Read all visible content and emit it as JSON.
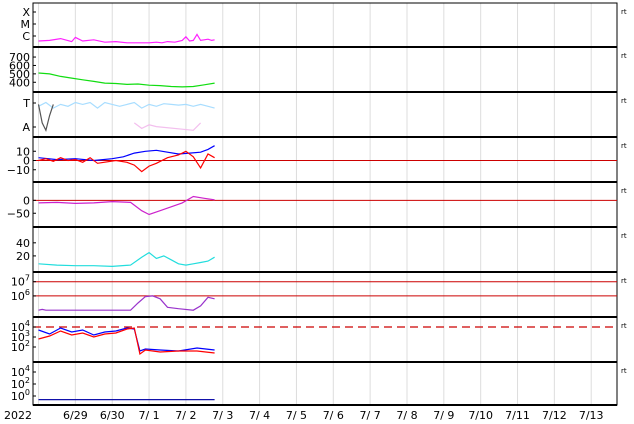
{
  "colors": {
    "magenta": "#ff22ff",
    "green": "#11dd11",
    "lightblue": "#a8ddff",
    "pink": "#f3bfee",
    "red": "#ff0000",
    "blue": "#0000ff",
    "purple": "#cc22cc",
    "cyan": "#22dddd",
    "violet": "#9933cc",
    "darkred": "#cc0000",
    "darkblue": "#1111aa",
    "gray": "#555555"
  },
  "chart_data": {
    "type": "line",
    "grid": true,
    "xlabel": "",
    "date_labels": [
      "2022",
      "6/29",
      "6/30",
      "7/ 1",
      "7/ 2",
      "7/ 3",
      "7/ 4",
      "7/ 5",
      "7/ 6",
      "7/ 7",
      "7/ 8",
      "7/ 9",
      "7/10",
      "7/11",
      "7/12",
      "7/13"
    ],
    "x_days": [
      "2022-06-28",
      "2022-06-29",
      "2022-06-30",
      "2022-07-01",
      "2022-07-02",
      "2022-07-03",
      "2022-07-04",
      "2022-07-05",
      "2022-07-06",
      "2022-07-07",
      "2022-07-08",
      "2022-07-09",
      "2022-07-10",
      "2022-07-11",
      "2022-07-12",
      "2022-07-13"
    ],
    "right_marker": "rt",
    "panels": [
      {
        "id": "xray",
        "tick_labels": [
          "X",
          "M",
          "C"
        ],
        "ylim": [
          0,
          3
        ],
        "series": [
          {
            "color": "magenta",
            "x": [
              0,
              0.3,
              0.6,
              0.9,
              1.0,
              1.2,
              1.5,
              1.8,
              2.1,
              2.4,
              2.7,
              3.0,
              3.2,
              3.35,
              3.5,
              3.7,
              3.9,
              4.0,
              4.1,
              4.2,
              4.3,
              4.4,
              4.5,
              4.6,
              4.7,
              4.78
            ],
            "y": [
              0.25,
              0.3,
              0.45,
              0.2,
              0.55,
              0.25,
              0.35,
              0.15,
              0.2,
              0.1,
              0.1,
              0.1,
              0.15,
              0.1,
              0.2,
              0.15,
              0.3,
              0.6,
              0.25,
              0.3,
              0.8,
              0.3,
              0.35,
              0.4,
              0.3,
              0.35
            ]
          }
        ]
      },
      {
        "id": "solar-wind-speed",
        "tick_labels": [
          "700",
          "600",
          "500",
          "400"
        ],
        "tick_values": [
          700,
          600,
          500,
          400
        ],
        "ylim": [
          320,
          760
        ],
        "series": [
          {
            "color": "green",
            "x": [
              0,
              0.3,
              0.6,
              0.9,
              1.2,
              1.5,
              1.8,
              2.1,
              2.4,
              2.7,
              3.0,
              3.3,
              3.6,
              3.9,
              4.2,
              4.5,
              4.78
            ],
            "y": [
              510,
              500,
              470,
              450,
              430,
              410,
              390,
              385,
              375,
              380,
              365,
              360,
              350,
              345,
              350,
              370,
              390
            ]
          }
        ]
      },
      {
        "id": "imf-direction",
        "tick_labels": [
          "T",
          "A"
        ],
        "ylim": [
          0,
          1
        ],
        "series": [
          {
            "color": "lightblue",
            "x": [
              0,
              0.2,
              0.4,
              0.6,
              0.8,
              1.0,
              1.2,
              1.4,
              1.6,
              1.8,
              2.0,
              2.2,
              2.4,
              2.6,
              2.8,
              3.0,
              3.2,
              3.4,
              3.6,
              3.8,
              4.0,
              4.2,
              4.4,
              4.6,
              4.78
            ],
            "y": [
              0.75,
              0.85,
              0.7,
              0.8,
              0.75,
              0.85,
              0.8,
              0.85,
              0.7,
              0.85,
              0.8,
              0.75,
              0.8,
              0.85,
              0.7,
              0.8,
              0.75,
              0.82,
              0.8,
              0.78,
              0.8,
              0.75,
              0.8,
              0.75,
              0.7
            ]
          },
          {
            "color": "pink",
            "x": [
              2.6,
              2.8,
              3.0,
              3.2,
              4.2,
              4.4
            ],
            "y": [
              0.3,
              0.15,
              0.25,
              0.2,
              0.1,
              0.3
            ]
          },
          {
            "color": "gray",
            "x": [
              0,
              0.1,
              0.2,
              0.3,
              0.4
            ],
            "y": [
              0.8,
              0.3,
              0.1,
              0.5,
              0.8
            ]
          }
        ]
      },
      {
        "id": "imf-bz",
        "tick_labels": [
          "10",
          "0",
          "−10"
        ],
        "tick_values": [
          10,
          0,
          -10
        ],
        "ylim": [
          -20,
          20
        ],
        "series": [
          {
            "color": "blue",
            "x": [
              0,
              0.5,
              1.0,
              1.5,
              2.0,
              2.3,
              2.6,
              2.9,
              3.2,
              3.5,
              3.8,
              4.1,
              4.4,
              4.6,
              4.78
            ],
            "y": [
              3,
              1,
              2,
              0,
              2,
              4,
              8,
              10,
              11,
              9,
              7,
              8,
              9,
              12,
              16
            ]
          },
          {
            "color": "red",
            "x": [
              0,
              0.2,
              0.4,
              0.6,
              0.8,
              1.0,
              1.2,
              1.4,
              1.6,
              2.1,
              2.4,
              2.6,
              2.8,
              3.0,
              3.2,
              3.5,
              3.8,
              4.0,
              4.2,
              4.4,
              4.6,
              4.78
            ],
            "y": [
              0,
              2,
              -1,
              3,
              0,
              1,
              -2,
              3,
              -3,
              0,
              -2,
              -5,
              -12,
              -6,
              -3,
              3,
              6,
              10,
              4,
              -8,
              7,
              3
            ]
          }
        ]
      },
      {
        "id": "dst",
        "tick_labels": [
          "0",
          "−50"
        ],
        "tick_values": [
          0,
          -50
        ],
        "ylim": [
          -80,
          40
        ],
        "series": [
          {
            "color": "purple",
            "x": [
              0,
              0.5,
              1.0,
              1.5,
              2.0,
              2.5,
              2.8,
              3.0,
              3.3,
              3.6,
              3.9,
              4.2,
              4.5,
              4.78
            ],
            "y": [
              -10,
              -8,
              -12,
              -10,
              -5,
              -8,
              -40,
              -55,
              -40,
              -25,
              -10,
              15,
              8,
              2
            ]
          }
        ]
      },
      {
        "id": "kp",
        "tick_labels": [
          "40",
          "20"
        ],
        "tick_values": [
          40,
          20
        ],
        "ylim": [
          0,
          55
        ],
        "series": [
          {
            "color": "cyan",
            "x": [
              0,
              0.5,
              1.0,
              1.5,
              2.0,
              2.5,
              2.8,
              3.0,
              3.2,
              3.4,
              3.6,
              3.8,
              4.0,
              4.2,
              4.4,
              4.6,
              4.78
            ],
            "y": [
              8,
              6,
              5,
              5,
              4,
              6,
              18,
              25,
              16,
              20,
              14,
              8,
              6,
              8,
              10,
              12,
              18
            ]
          }
        ]
      },
      {
        "id": "electron-flux",
        "tick_labels": [
          "10^7",
          "10^6"
        ],
        "tick_values": [
          7,
          6
        ],
        "ylim": [
          4.8,
          7.4
        ],
        "series": [
          {
            "color": "violet",
            "x": [
              0,
              0.1,
              0.2,
              2.5,
              2.7,
              2.9,
              3.1,
              3.3,
              3.5,
              3.8,
              4.2,
              4.4,
              4.6,
              4.78
            ],
            "y": [
              5.0,
              5.05,
              5.0,
              5.0,
              5.5,
              5.95,
              6.0,
              5.8,
              5.2,
              5.1,
              5.0,
              5.3,
              5.9,
              5.8
            ]
          }
        ]
      },
      {
        "id": "proton-flux",
        "tick_labels": [
          "10^4",
          "10^3",
          "10^2"
        ],
        "tick_values": [
          4,
          3,
          2
        ],
        "ylim": [
          0.8,
          4.5
        ],
        "series": [
          {
            "color": "blue",
            "x": [
              0,
              0.3,
              0.6,
              0.9,
              1.2,
              1.5,
              1.8,
              2.1,
              2.4,
              2.6,
              2.75,
              2.9,
              3.3,
              3.8,
              4.3,
              4.78
            ],
            "y": [
              3.7,
              3.3,
              3.9,
              3.5,
              3.7,
              3.2,
              3.5,
              3.6,
              3.9,
              3.8,
              1.6,
              1.8,
              1.7,
              1.6,
              1.9,
              1.7
            ]
          },
          {
            "color": "red",
            "x": [
              0,
              0.3,
              0.6,
              0.9,
              1.2,
              1.5,
              1.8,
              2.1,
              2.4,
              2.6,
              2.75,
              2.9,
              3.3,
              3.8,
              4.3,
              4.78
            ],
            "y": [
              2.8,
              3.1,
              3.6,
              3.2,
              3.4,
              3.0,
              3.3,
              3.4,
              3.8,
              3.9,
              1.3,
              1.7,
              1.5,
              1.6,
              1.6,
              1.4
            ]
          }
        ]
      },
      {
        "id": "ion-flux",
        "tick_labels": [
          "10^4",
          "10^2",
          "10^0"
        ],
        "tick_values": [
          4,
          2,
          0
        ],
        "ylim": [
          -1,
          5
        ],
        "series": [
          {
            "color": "darkblue",
            "x": [
              0,
              1,
              2,
              3,
              4,
              4.78
            ],
            "y": [
              -0.6,
              -0.6,
              -0.6,
              -0.6,
              -0.6,
              -0.6
            ]
          }
        ]
      }
    ]
  }
}
